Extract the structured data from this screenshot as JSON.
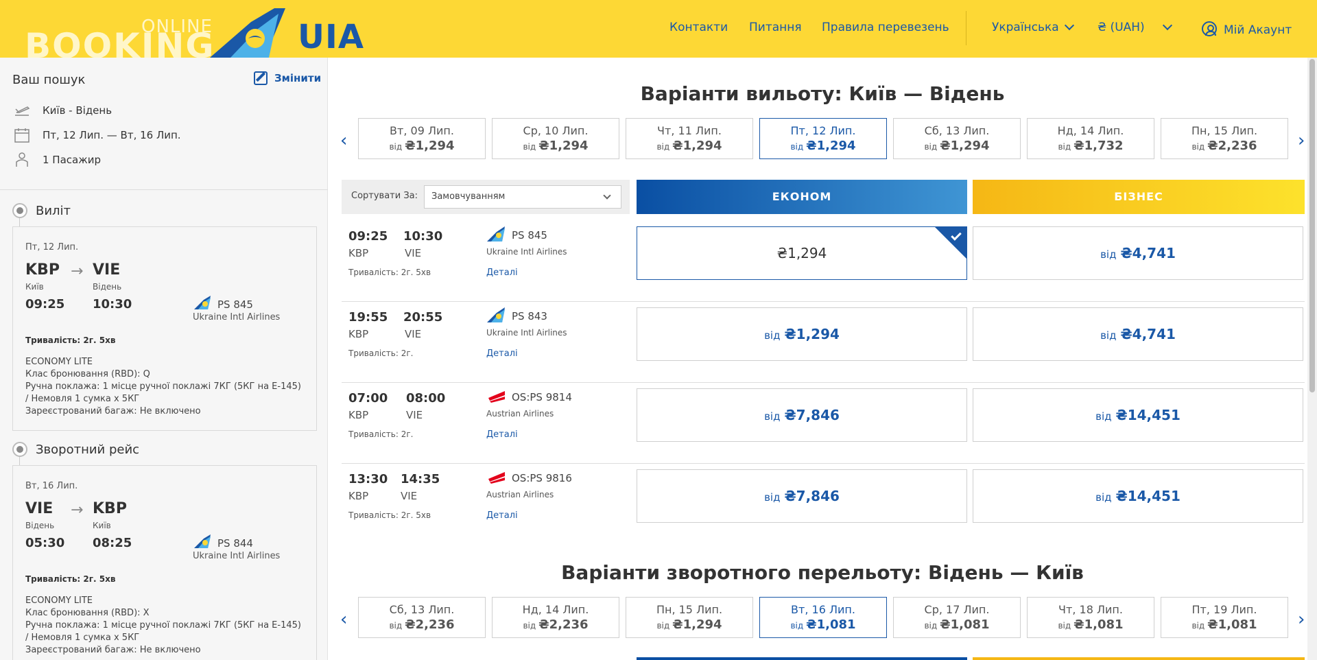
{
  "header": {
    "logo_online": "ONLINE",
    "logo_booking": "BOOKING",
    "logo_brand": "UIA",
    "nav": [
      "Контакти",
      "Питання",
      "Правила перевезень"
    ],
    "language": "Українська",
    "currency": "₴ (UAH)",
    "account": "Мій Акаунт",
    "colors": {
      "header_bg": "#fdd835",
      "brand_blue": "#1a58a7"
    }
  },
  "sidebar": {
    "title": "Ваш пошук",
    "change": "Змінити",
    "route": "Київ - Відень",
    "dates": "Пт, 12 Лип. — Вт, 16 Лип.",
    "passengers": "1 Пасажир",
    "outbound": {
      "heading": "Виліт",
      "date": "Пт, 12 Лип.",
      "from_code": "KBP",
      "to_code": "VIE",
      "from_city": "Київ",
      "to_city": "Відень",
      "dep": "09:25",
      "arr": "10:30",
      "flight": "PS 845",
      "airline": "Ukraine Intl Airlines",
      "duration": "Тривалість: 2г. 5хв",
      "fare": "ECONOMY LITE",
      "rbd": "Клас бронювання (RBD):  Q",
      "hand_luggage": "Ручна поклажа: 1 місце ручної поклажі 7КГ (5КГ на Е-145) / Немовля 1 сумка х 5КГ",
      "checked": "Зареєстрований багаж: Не включено"
    },
    "inbound": {
      "heading": "Зворотний рейс",
      "date": "Вт, 16 Лип.",
      "from_code": "VIE",
      "to_code": "KBP",
      "from_city": "Відень",
      "to_city": "Київ",
      "dep": "05:30",
      "arr": "08:25",
      "flight": "PS 844",
      "airline": "Ukraine Intl Airlines",
      "duration": "Тривалість: 2г. 5хв",
      "fare": "ECONOMY LITE",
      "rbd": "Клас бронювання (RBD):  X",
      "hand_luggage": "Ручна поклажа: 1 місце ручної поклажі 7КГ (5КГ на Е-145) / Немовля 1 сумка х 5КГ",
      "checked": "Зареєстрований багаж: Не включено"
    }
  },
  "main": {
    "outbound_title": "Варіанти вильоту: Київ — Відень",
    "inbound_title": "Варіанти зворотного перельоту: Відень — Київ",
    "from_label": "від",
    "outbound_dates": [
      {
        "day": "Вт, 09 Лип.",
        "price": "₴1,294"
      },
      {
        "day": "Ср, 10 Лип.",
        "price": "₴1,294"
      },
      {
        "day": "Чт, 11 Лип.",
        "price": "₴1,294"
      },
      {
        "day": "Пт, 12 Лип.",
        "price": "₴1,294"
      },
      {
        "day": "Сб, 13 Лип.",
        "price": "₴1,294"
      },
      {
        "day": "Нд, 14 Лип.",
        "price": "₴1,732"
      },
      {
        "day": "Пн, 15 Лип.",
        "price": "₴2,236"
      }
    ],
    "inbound_dates": [
      {
        "day": "Сб, 13 Лип.",
        "price": "₴2,236"
      },
      {
        "day": "Нд, 14 Лип.",
        "price": "₴2,236"
      },
      {
        "day": "Пн, 15 Лип.",
        "price": "₴1,294"
      },
      {
        "day": "Вт, 16 Лип.",
        "price": "₴1,081"
      },
      {
        "day": "Ср, 17 Лип.",
        "price": "₴1,081"
      },
      {
        "day": "Чт, 18 Лип.",
        "price": "₴1,081"
      },
      {
        "day": "Пт, 19 Лип.",
        "price": "₴1,081"
      }
    ],
    "sort_label": "Сортувати За:",
    "sort_value": "Замовчуванням",
    "econom_label": "ЕКОНОМ",
    "business_label": "БІЗНЕС",
    "details_label": "Деталі",
    "flights": [
      {
        "dep": "09:25",
        "arr": "10:30",
        "from": "KBP",
        "to": "VIE",
        "duration": "Тривалість: 2г. 5хв",
        "flight": "PS 845",
        "airline": "Ukraine Intl Airlines",
        "econom": "₴1,294",
        "business": "₴4,741"
      },
      {
        "dep": "19:55",
        "arr": "20:55",
        "from": "KBP",
        "to": "VIE",
        "duration": "Тривалість: 2г.",
        "flight": "PS 843",
        "airline": "Ukraine Intl Airlines",
        "econom": "₴1,294",
        "business": "₴4,741"
      },
      {
        "dep": "07:00",
        "arr": "08:00",
        "from": "KBP",
        "to": "VIE",
        "duration": "Тривалість: 2г.",
        "flight": "OS:PS 9814",
        "airline": "Austrian Airlines",
        "econom": "₴7,846",
        "business": "₴14,451"
      },
      {
        "dep": "13:30",
        "arr": "14:35",
        "from": "KBP",
        "to": "VIE",
        "duration": "Тривалість: 2г. 5хв",
        "flight": "OS:PS 9816",
        "airline": "Austrian Airlines",
        "econom": "₴7,846",
        "business": "₴14,451"
      }
    ]
  }
}
